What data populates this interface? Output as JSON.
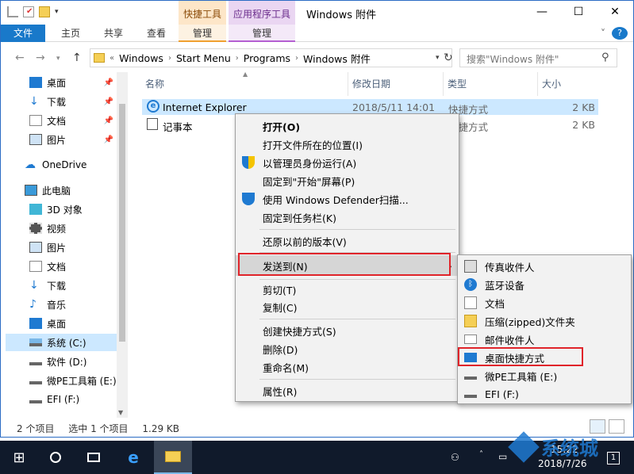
{
  "window": {
    "title": "Windows 附件",
    "context_tabs": [
      "快捷工具",
      "应用程序工具"
    ],
    "controls": {
      "minimize": "—",
      "maximize": "☐",
      "close": "✕"
    }
  },
  "ribbon": {
    "tabs": [
      "文件",
      "主页",
      "共享",
      "查看",
      "管理",
      "管理"
    ],
    "help": "?"
  },
  "address": {
    "overflow": "«",
    "crumbs": [
      "Windows",
      "Start Menu",
      "Programs",
      "Windows 附件"
    ],
    "search_placeholder": "搜索\"Windows 附件\""
  },
  "sidebar": {
    "quick_access": [
      "桌面",
      "下载",
      "文档",
      "图片"
    ],
    "onedrive": "OneDrive",
    "this_pc": "此电脑",
    "pc_items": [
      "3D 对象",
      "视频",
      "图片",
      "文档",
      "下载",
      "音乐",
      "桌面",
      "系统 (C:)",
      "软件 (D:)",
      "微PE工具箱 (E:)",
      "EFI (F:)"
    ]
  },
  "columns": {
    "name": "名称",
    "date": "修改日期",
    "type": "类型",
    "size": "大小"
  },
  "files": [
    {
      "name": "Internet Explorer",
      "date": "2018/5/11 14:01",
      "type": "快捷方式",
      "size": "2 KB"
    },
    {
      "name": "记事本",
      "date": "",
      "type": "快捷方式",
      "size": "2 KB"
    }
  ],
  "status": {
    "count": "2 个项目",
    "selected": "选中 1 个项目",
    "size": "1.29 KB"
  },
  "context_menu": [
    "打开(O)",
    "打开文件所在的位置(I)",
    "以管理员身份运行(A)",
    "固定到\"开始\"屏幕(P)",
    "使用 Windows Defender扫描...",
    "固定到任务栏(K)",
    "还原以前的版本(V)",
    "发送到(N)",
    "剪切(T)",
    "复制(C)",
    "创建快捷方式(S)",
    "删除(D)",
    "重命名(M)",
    "属性(R)"
  ],
  "submenu": [
    "传真收件人",
    "蓝牙设备",
    "文档",
    "压缩(zipped)文件夹",
    "邮件收件人",
    "桌面快捷方式",
    "微PE工具箱 (E:)",
    "EFI (F:)"
  ],
  "taskbar": {
    "time": "15:22",
    "date": "2018/7/26",
    "notifications": "1"
  },
  "watermark": "系统城",
  "colors": {
    "accent": "#1979ca",
    "selection": "#cce8ff",
    "highlight_box": "#e0242a",
    "taskbar": "#101a2b"
  }
}
